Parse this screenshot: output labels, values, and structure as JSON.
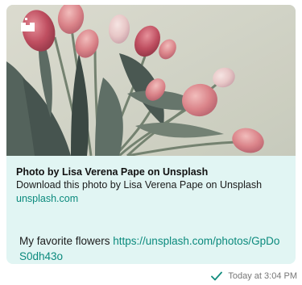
{
  "message": {
    "preview": {
      "image_icon": "photo-icon",
      "title": "Photo by Lisa Verena Pape on Unsplash",
      "description": "Download this photo by Lisa Verena Pape on Unsplash",
      "domain": "unsplash.com"
    },
    "text": "My favorite flowers ",
    "link": "https://unsplash.com/photos/GpDoS0dh43o",
    "timestamp": "Today at 3:04 PM",
    "status_icon": "check-icon",
    "colors": {
      "bubble": "#e1f5f3",
      "link": "#0b8a7d",
      "check": "#128c7e"
    }
  }
}
